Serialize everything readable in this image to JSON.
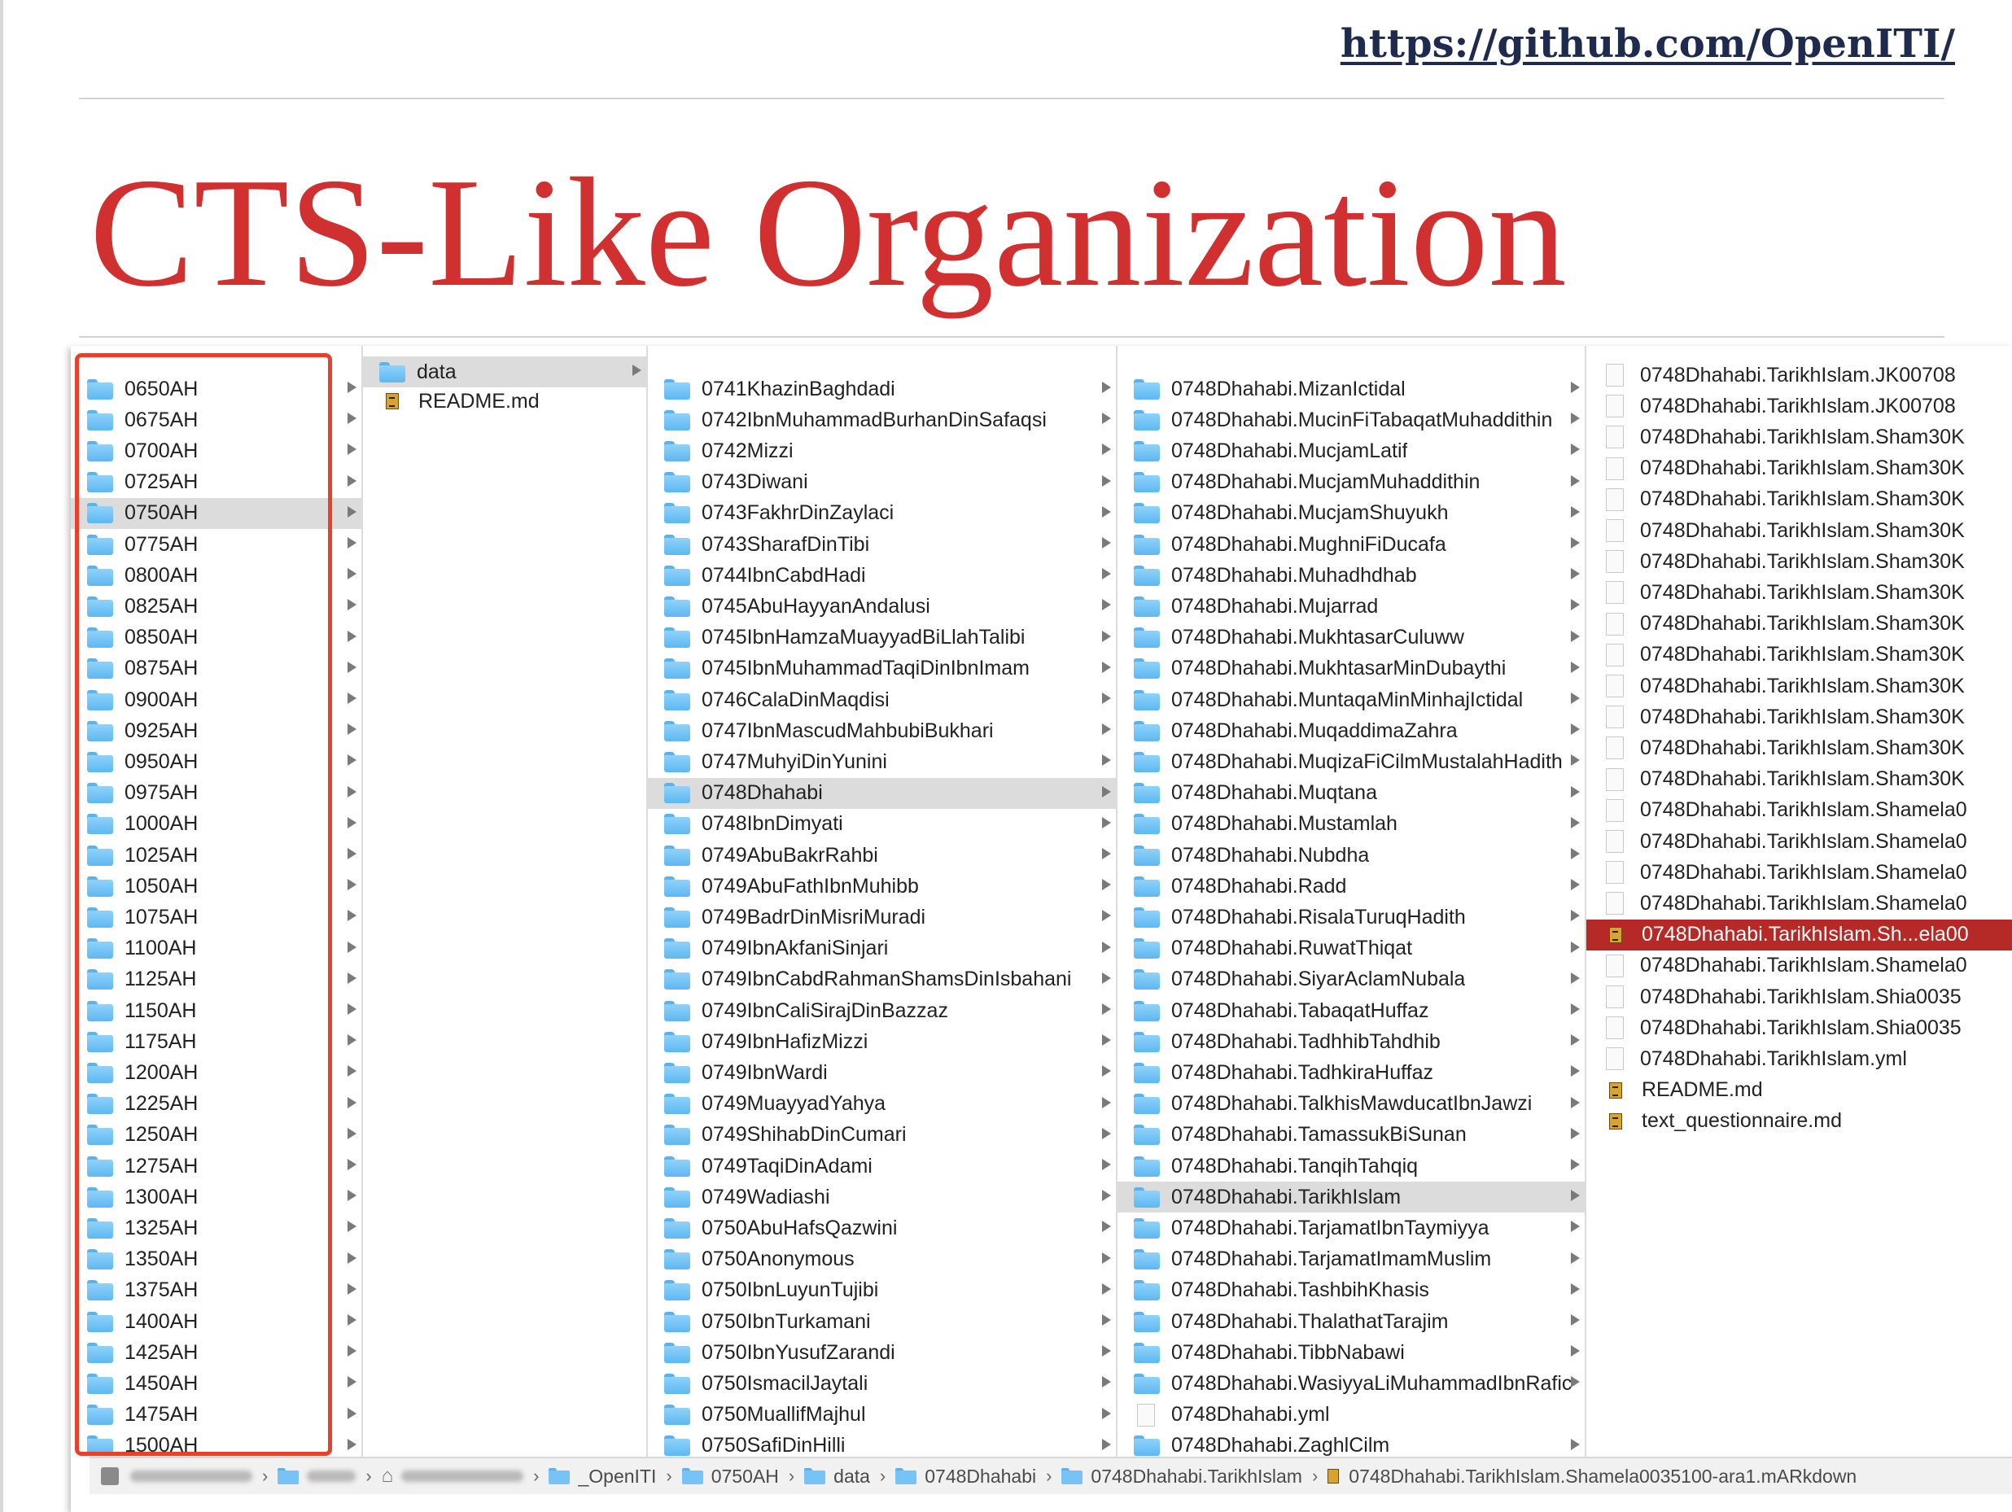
{
  "slide": {
    "link": "https://github.com/OpenITI/",
    "title": "CTS-Like Organization"
  },
  "finder": {
    "columns": [
      {
        "name": "century-folders",
        "items": [
          {
            "label": "0650AH",
            "kind": "folder"
          },
          {
            "label": "0675AH",
            "kind": "folder"
          },
          {
            "label": "0700AH",
            "kind": "folder"
          },
          {
            "label": "0725AH",
            "kind": "folder"
          },
          {
            "label": "0750AH",
            "kind": "folder",
            "selected": true
          },
          {
            "label": "0775AH",
            "kind": "folder"
          },
          {
            "label": "0800AH",
            "kind": "folder"
          },
          {
            "label": "0825AH",
            "kind": "folder"
          },
          {
            "label": "0850AH",
            "kind": "folder"
          },
          {
            "label": "0875AH",
            "kind": "folder"
          },
          {
            "label": "0900AH",
            "kind": "folder"
          },
          {
            "label": "0925AH",
            "kind": "folder"
          },
          {
            "label": "0950AH",
            "kind": "folder"
          },
          {
            "label": "0975AH",
            "kind": "folder"
          },
          {
            "label": "1000AH",
            "kind": "folder"
          },
          {
            "label": "1025AH",
            "kind": "folder"
          },
          {
            "label": "1050AH",
            "kind": "folder"
          },
          {
            "label": "1075AH",
            "kind": "folder"
          },
          {
            "label": "1100AH",
            "kind": "folder"
          },
          {
            "label": "1125AH",
            "kind": "folder"
          },
          {
            "label": "1150AH",
            "kind": "folder"
          },
          {
            "label": "1175AH",
            "kind": "folder"
          },
          {
            "label": "1200AH",
            "kind": "folder"
          },
          {
            "label": "1225AH",
            "kind": "folder"
          },
          {
            "label": "1250AH",
            "kind": "folder"
          },
          {
            "label": "1275AH",
            "kind": "folder"
          },
          {
            "label": "1300AH",
            "kind": "folder"
          },
          {
            "label": "1325AH",
            "kind": "folder"
          },
          {
            "label": "1350AH",
            "kind": "folder"
          },
          {
            "label": "1375AH",
            "kind": "folder"
          },
          {
            "label": "1400AH",
            "kind": "folder"
          },
          {
            "label": "1425AH",
            "kind": "folder"
          },
          {
            "label": "1450AH",
            "kind": "folder"
          },
          {
            "label": "1475AH",
            "kind": "folder"
          },
          {
            "label": "1500AH",
            "kind": "folder"
          }
        ]
      },
      {
        "name": "repo-contents",
        "items": [
          {
            "label": "data",
            "kind": "folder",
            "selected": true
          },
          {
            "label": "README.md",
            "kind": "md"
          }
        ]
      },
      {
        "name": "authors",
        "items": [
          {
            "label": "0741KhazinBaghdadi",
            "kind": "folder"
          },
          {
            "label": "0742IbnMuhammadBurhanDinSafaqsi",
            "kind": "folder"
          },
          {
            "label": "0742Mizzi",
            "kind": "folder"
          },
          {
            "label": "0743Diwani",
            "kind": "folder"
          },
          {
            "label": "0743FakhrDinZaylaci",
            "kind": "folder"
          },
          {
            "label": "0743SharafDinTibi",
            "kind": "folder"
          },
          {
            "label": "0744IbnCabdHadi",
            "kind": "folder"
          },
          {
            "label": "0745AbuHayyanAndalusi",
            "kind": "folder"
          },
          {
            "label": "0745IbnHamzaMuayyadBiLlahTalibi",
            "kind": "folder"
          },
          {
            "label": "0745IbnMuhammadTaqiDinIbnImam",
            "kind": "folder"
          },
          {
            "label": "0746CalaDinMaqdisi",
            "kind": "folder"
          },
          {
            "label": "0747IbnMascudMahbubiBukhari",
            "kind": "folder"
          },
          {
            "label": "0747MuhyiDinYunini",
            "kind": "folder"
          },
          {
            "label": "0748Dhahabi",
            "kind": "folder",
            "selected": true
          },
          {
            "label": "0748IbnDimyati",
            "kind": "folder"
          },
          {
            "label": "0749AbuBakrRahbi",
            "kind": "folder"
          },
          {
            "label": "0749AbuFathIbnMuhibb",
            "kind": "folder"
          },
          {
            "label": "0749BadrDinMisriMuradi",
            "kind": "folder"
          },
          {
            "label": "0749IbnAkfaniSinjari",
            "kind": "folder"
          },
          {
            "label": "0749IbnCabdRahmanShamsDinIsbahani",
            "kind": "folder"
          },
          {
            "label": "0749IbnCaliSirajDinBazzaz",
            "kind": "folder"
          },
          {
            "label": "0749IbnHafizMizzi",
            "kind": "folder"
          },
          {
            "label": "0749IbnWardi",
            "kind": "folder"
          },
          {
            "label": "0749MuayyadYahya",
            "kind": "folder"
          },
          {
            "label": "0749ShihabDinCumari",
            "kind": "folder"
          },
          {
            "label": "0749TaqiDinAdami",
            "kind": "folder"
          },
          {
            "label": "0749Wadiashi",
            "kind": "folder"
          },
          {
            "label": "0750AbuHafsQazwini",
            "kind": "folder"
          },
          {
            "label": "0750Anonymous",
            "kind": "folder"
          },
          {
            "label": "0750IbnLuyunTujibi",
            "kind": "folder"
          },
          {
            "label": "0750IbnTurkamani",
            "kind": "folder"
          },
          {
            "label": "0750IbnYusufZarandi",
            "kind": "folder"
          },
          {
            "label": "0750IsmacilJaytali",
            "kind": "folder"
          },
          {
            "label": "0750MuallifMajhul",
            "kind": "folder"
          },
          {
            "label": "0750SafiDinHilli",
            "kind": "folder"
          }
        ]
      },
      {
        "name": "works",
        "items": [
          {
            "label": "0748Dhahabi.MizanIctidal",
            "kind": "folder"
          },
          {
            "label": "0748Dhahabi.MucinFiTabaqatMuhaddithin",
            "kind": "folder"
          },
          {
            "label": "0748Dhahabi.MucjamLatif",
            "kind": "folder"
          },
          {
            "label": "0748Dhahabi.MucjamMuhaddithin",
            "kind": "folder"
          },
          {
            "label": "0748Dhahabi.MucjamShuyukh",
            "kind": "folder"
          },
          {
            "label": "0748Dhahabi.MughniFiDucafa",
            "kind": "folder"
          },
          {
            "label": "0748Dhahabi.Muhadhdhab",
            "kind": "folder"
          },
          {
            "label": "0748Dhahabi.Mujarrad",
            "kind": "folder"
          },
          {
            "label": "0748Dhahabi.MukhtasarCuluww",
            "kind": "folder"
          },
          {
            "label": "0748Dhahabi.MukhtasarMinDubaythi",
            "kind": "folder"
          },
          {
            "label": "0748Dhahabi.MuntaqaMinMinhajIctidal",
            "kind": "folder"
          },
          {
            "label": "0748Dhahabi.MuqaddimaZahra",
            "kind": "folder"
          },
          {
            "label": "0748Dhahabi.MuqizaFiCilmMustalahHadith",
            "kind": "folder"
          },
          {
            "label": "0748Dhahabi.Muqtana",
            "kind": "folder"
          },
          {
            "label": "0748Dhahabi.Mustamlah",
            "kind": "folder"
          },
          {
            "label": "0748Dhahabi.Nubdha",
            "kind": "folder"
          },
          {
            "label": "0748Dhahabi.Radd",
            "kind": "folder"
          },
          {
            "label": "0748Dhahabi.RisalaTuruqHadith",
            "kind": "folder"
          },
          {
            "label": "0748Dhahabi.RuwatThiqat",
            "kind": "folder"
          },
          {
            "label": "0748Dhahabi.SiyarAclamNubala",
            "kind": "folder"
          },
          {
            "label": "0748Dhahabi.TabaqatHuffaz",
            "kind": "folder"
          },
          {
            "label": "0748Dhahabi.TadhhibTahdhib",
            "kind": "folder"
          },
          {
            "label": "0748Dhahabi.TadhkiraHuffaz",
            "kind": "folder"
          },
          {
            "label": "0748Dhahabi.TalkhisMawducatIbnJawzi",
            "kind": "folder"
          },
          {
            "label": "0748Dhahabi.TamassukBiSunan",
            "kind": "folder"
          },
          {
            "label": "0748Dhahabi.TanqihTahqiq",
            "kind": "folder"
          },
          {
            "label": "0748Dhahabi.TarikhIslam",
            "kind": "folder",
            "selected": true
          },
          {
            "label": "0748Dhahabi.TarjamatIbnTaymiyya",
            "kind": "folder"
          },
          {
            "label": "0748Dhahabi.TarjamatImamMuslim",
            "kind": "folder"
          },
          {
            "label": "0748Dhahabi.TashbihKhasis",
            "kind": "folder"
          },
          {
            "label": "0748Dhahabi.ThalathatTarajim",
            "kind": "folder"
          },
          {
            "label": "0748Dhahabi.TibbNabawi",
            "kind": "folder"
          },
          {
            "label": "0748Dhahabi.WasiyyaLiMuhammadIbnRafic",
            "kind": "folder"
          },
          {
            "label": "0748Dhahabi.yml",
            "kind": "doc"
          },
          {
            "label": "0748Dhahabi.ZaghlCilm",
            "kind": "folder"
          }
        ]
      },
      {
        "name": "versions",
        "items": [
          {
            "label": "0748Dhahabi.TarikhIslam.JK00708",
            "kind": "doc"
          },
          {
            "label": "0748Dhahabi.TarikhIslam.JK00708",
            "kind": "doc"
          },
          {
            "label": "0748Dhahabi.TarikhIslam.Sham30K",
            "kind": "doc"
          },
          {
            "label": "0748Dhahabi.TarikhIslam.Sham30K",
            "kind": "doc"
          },
          {
            "label": "0748Dhahabi.TarikhIslam.Sham30K",
            "kind": "doc"
          },
          {
            "label": "0748Dhahabi.TarikhIslam.Sham30K",
            "kind": "doc"
          },
          {
            "label": "0748Dhahabi.TarikhIslam.Sham30K",
            "kind": "doc"
          },
          {
            "label": "0748Dhahabi.TarikhIslam.Sham30K",
            "kind": "doc"
          },
          {
            "label": "0748Dhahabi.TarikhIslam.Sham30K",
            "kind": "doc"
          },
          {
            "label": "0748Dhahabi.TarikhIslam.Sham30K",
            "kind": "doc"
          },
          {
            "label": "0748Dhahabi.TarikhIslam.Sham30K",
            "kind": "doc"
          },
          {
            "label": "0748Dhahabi.TarikhIslam.Sham30K",
            "kind": "doc"
          },
          {
            "label": "0748Dhahabi.TarikhIslam.Sham30K",
            "kind": "doc"
          },
          {
            "label": "0748Dhahabi.TarikhIslam.Sham30K",
            "kind": "doc"
          },
          {
            "label": "0748Dhahabi.TarikhIslam.Shamela0",
            "kind": "doc"
          },
          {
            "label": "0748Dhahabi.TarikhIslam.Shamela0",
            "kind": "doc"
          },
          {
            "label": "0748Dhahabi.TarikhIslam.Shamela0",
            "kind": "doc"
          },
          {
            "label": "0748Dhahabi.TarikhIslam.Shamela0",
            "kind": "doc"
          },
          {
            "label": "0748Dhahabi.TarikhIslam.Sh...ela00",
            "kind": "md",
            "highlighted": true
          },
          {
            "label": "0748Dhahabi.TarikhIslam.Shamela0",
            "kind": "doc"
          },
          {
            "label": "0748Dhahabi.TarikhIslam.Shia0035",
            "kind": "doc"
          },
          {
            "label": "0748Dhahabi.TarikhIslam.Shia0035",
            "kind": "doc"
          },
          {
            "label": "0748Dhahabi.TarikhIslam.yml",
            "kind": "doc"
          },
          {
            "label": "README.md",
            "kind": "md"
          },
          {
            "label": "text_questionnaire.md",
            "kind": "md"
          }
        ]
      }
    ],
    "pathbar": [
      "_OpenITI",
      "0750AH",
      "data",
      "0748Dhahabi",
      "0748Dhahabi.TarikhIslam",
      "0748Dhahabi.TarikhIslam.Shamela0035100-ara1.mARkdown"
    ]
  }
}
